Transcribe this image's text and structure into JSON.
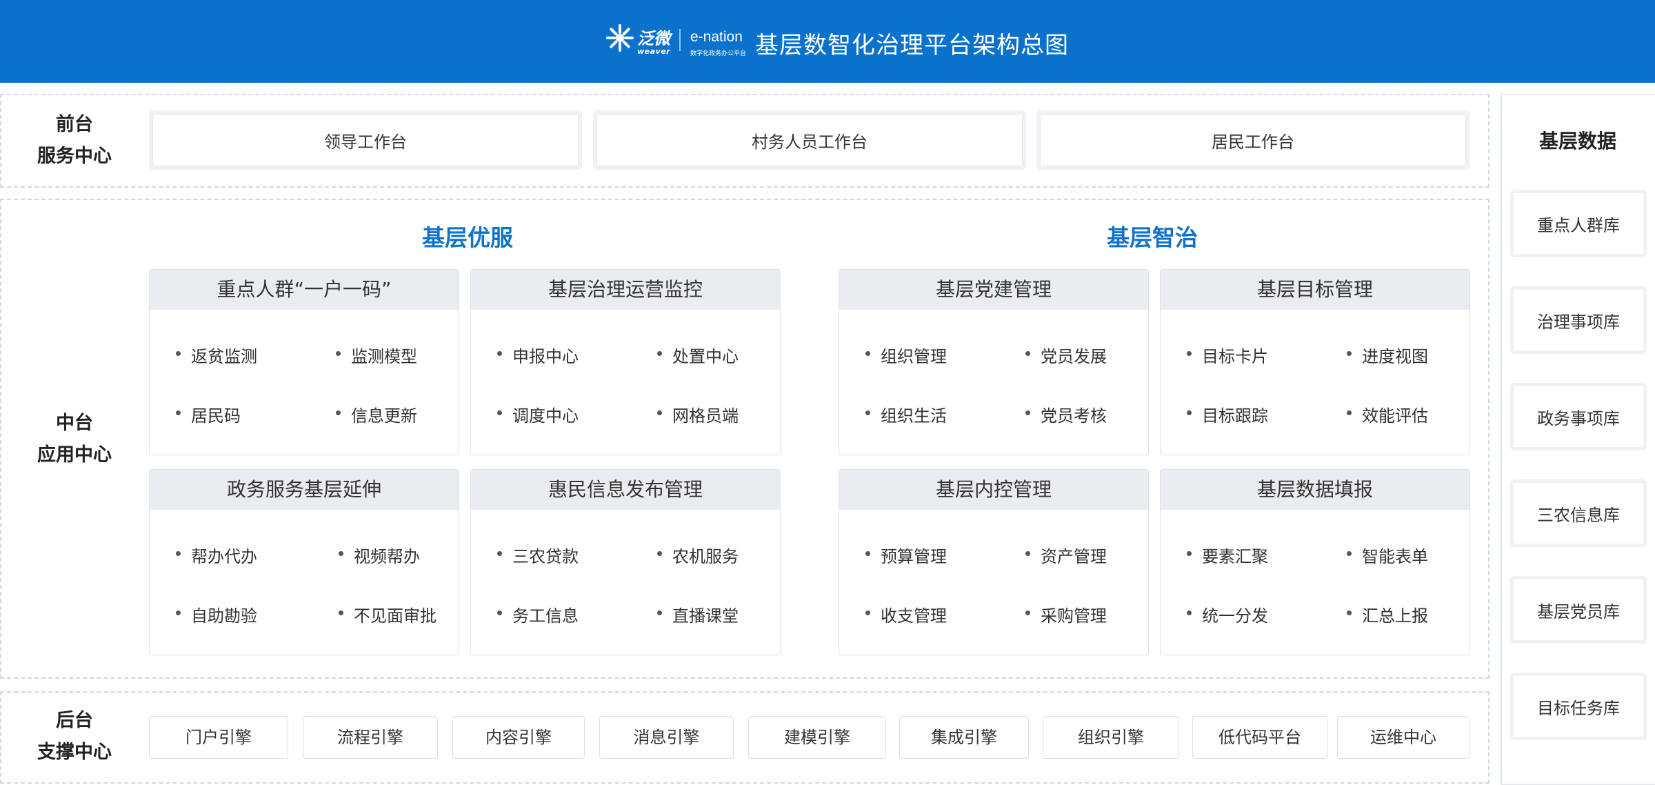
{
  "header": {
    "logo_cn": "泛微",
    "logo_weaver": "weaver",
    "logo_en": "e-nation",
    "logo_sub": "数字化政务办公平台",
    "title": "基层数智化治理平台架构总图",
    "background": "#0a72cc"
  },
  "front": {
    "label_line1": "前台",
    "label_line2": "服务中心",
    "workbenches": [
      "领导工作台",
      "村务人员工作台",
      "居民工作台"
    ]
  },
  "middle": {
    "label_line1": "中台",
    "label_line2": "应用中心",
    "group_color": "#1172c8",
    "groups": [
      {
        "title": "基层优服",
        "cards": [
          {
            "title": "重点人群“一户一码”",
            "items": [
              "返贫监测",
              "监测模型",
              "居民码",
              "信息更新"
            ]
          },
          {
            "title": "基层治理运营监控",
            "items": [
              "申报中心",
              "处置中心",
              "调度中心",
              "网格员端"
            ]
          },
          {
            "title": "政务服务基层延伸",
            "items": [
              "帮办代办",
              "视频帮办",
              "自助勘验",
              "不见面审批"
            ]
          },
          {
            "title": "惠民信息发布管理",
            "items": [
              "三农贷款",
              "农机服务",
              "务工信息",
              "直播课堂"
            ]
          }
        ]
      },
      {
        "title": "基层智治",
        "cards": [
          {
            "title": "基层党建管理",
            "items": [
              "组织管理",
              "党员发展",
              "组织生活",
              "党员考核"
            ]
          },
          {
            "title": "基层目标管理",
            "items": [
              "目标卡片",
              "进度视图",
              "目标跟踪",
              "效能评估"
            ]
          },
          {
            "title": "基层内控管理",
            "items": [
              "预算管理",
              "资产管理",
              "收支管理",
              "采购管理"
            ]
          },
          {
            "title": "基层数据填报",
            "items": [
              "要素汇聚",
              "智能表单",
              "统一分发",
              "汇总上报"
            ]
          }
        ]
      }
    ]
  },
  "back": {
    "label_line1": "后台",
    "label_line2": "支撑中心",
    "engines": [
      "门户引擎",
      "流程引擎",
      "内容引擎",
      "消息引擎",
      "建模引擎",
      "集成引擎",
      "组织引擎",
      "低代码平台",
      "运维中心"
    ]
  },
  "data_panel": {
    "title": "基层数据",
    "items": [
      "重点人群库",
      "治理事项库",
      "政务事项库",
      "三农信息库",
      "基层党员库",
      "目标任务库"
    ]
  }
}
